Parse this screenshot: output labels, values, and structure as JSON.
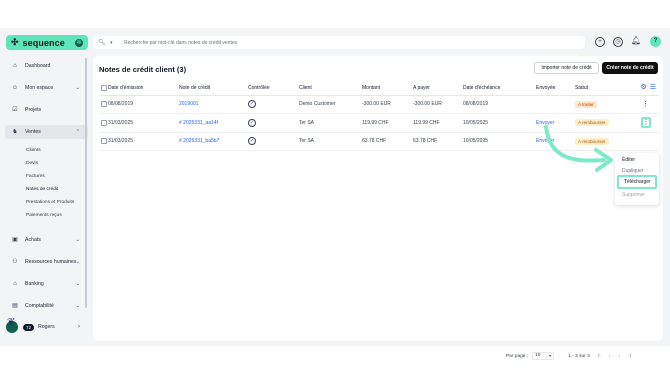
{
  "brand": {
    "name": "sequence",
    "badge": "✻"
  },
  "search": {
    "placeholder": "Recherche par mot-clé dans notes de crédit ventes",
    "icon": "search-icon"
  },
  "topbar": {
    "avatar": "?"
  },
  "sidebar": {
    "items": [
      {
        "label": "Dashboard",
        "icon": "dashboard-icon"
      },
      {
        "label": "Mon espace",
        "icon": "user-icon"
      },
      {
        "label": "Projets",
        "icon": "check-square-icon"
      },
      {
        "label": "Ventes",
        "icon": "ventes-icon"
      },
      {
        "label": "Achats",
        "icon": "bag-icon"
      },
      {
        "label": "Ressources humaines",
        "icon": "people-icon"
      },
      {
        "label": "Banking",
        "icon": "bank-icon"
      },
      {
        "label": "Comptabilité",
        "icon": "ledger-icon"
      }
    ],
    "ventes_sub": [
      "Clients",
      "Devis",
      "Factures",
      "Notes de crédit",
      "Prestations et Produits",
      "Paiements reçus"
    ],
    "user": {
      "count": "72",
      "name": "Rogers"
    }
  },
  "main": {
    "title": "Notes de crédit client (3)",
    "import_label": "Importer note de crédit",
    "create_label": "Créer note de crédit",
    "columns": [
      "Date d'émission",
      "Note de crédit",
      "Contrôlée",
      "Client",
      "Montant",
      "A payer",
      "Date d'échéance",
      "Envoyée",
      "Statut"
    ],
    "rows": [
      {
        "date": "08/08/2019",
        "note": "2019001",
        "client": "Demo Customer",
        "montant": "-300.00 EUR",
        "a_payer": "-300.00 EUR",
        "echeance": "08/08/2019",
        "envoyee": "",
        "statut": "A traiter",
        "statut_kind": "todo"
      },
      {
        "date": "31/03/2025",
        "note": "# 2025331_aa14f",
        "client": "Ter SA",
        "montant": "119.99 CHF",
        "a_payer": "119.99 CHF",
        "echeance": "10/05/2025",
        "envoyee": "Envoyer",
        "statut": "A rembourser",
        "statut_kind": "refund"
      },
      {
        "date": "31/03/2025",
        "note": "# 2025331_ba5b7",
        "client": "Ter SA",
        "montant": "63.78 CHF",
        "a_payer": "63.78 CHF",
        "echeance": "10/05/2025",
        "envoyee": "Envoyer",
        "statut": "A rembourser",
        "statut_kind": "refund"
      }
    ]
  },
  "menu": {
    "edit": "Éditer",
    "duplicate": "Dupliquer",
    "download": "Télécharger",
    "delete": "Supprimer"
  },
  "pager": {
    "per_page_label": "Par page :",
    "per_page_value": "10",
    "range": "1 - 3 sur 3"
  },
  "colors": {
    "accent": "#5ee6b8",
    "highlight": "#7de9c9",
    "link": "#2563eb",
    "primary_button": "#111111"
  }
}
